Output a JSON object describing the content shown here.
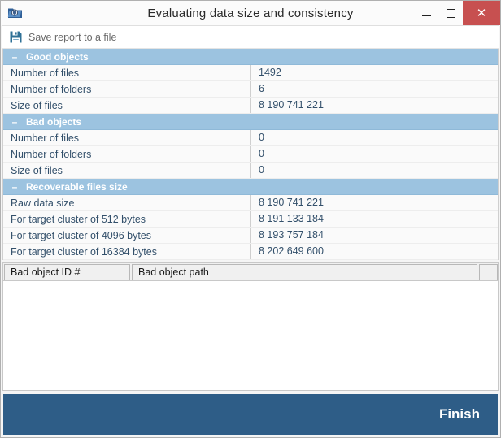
{
  "window": {
    "title": "Evaluating data size and consistency",
    "app_icon": "folder-shield-icon",
    "controls": {
      "minimize": "–",
      "maximize": "□",
      "close": "✕"
    },
    "close_color": "#c75050"
  },
  "toolbar": {
    "save_icon": "floppy-disk-icon",
    "save_label": "Save report to a file"
  },
  "sections": [
    {
      "title": "Good objects",
      "toggle": "–",
      "rows": [
        {
          "label": "Number of files",
          "value": "1492"
        },
        {
          "label": "Number of folders",
          "value": "6"
        },
        {
          "label": "Size of files",
          "value": "8 190 741 221"
        }
      ]
    },
    {
      "title": "Bad objects",
      "toggle": "–",
      "rows": [
        {
          "label": "Number of files",
          "value": "0"
        },
        {
          "label": "Number of folders",
          "value": "0"
        },
        {
          "label": "Size of files",
          "value": "0"
        }
      ]
    },
    {
      "title": "Recoverable files size",
      "toggle": "–",
      "rows": [
        {
          "label": "Raw data size",
          "value": "8 190 741 221"
        },
        {
          "label": "For target cluster of 512 bytes",
          "value": "8 191 133 184"
        },
        {
          "label": "For target cluster of 4096 bytes",
          "value": "8 193 757 184"
        },
        {
          "label": "For target cluster of 16384 bytes",
          "value": "8 202 649 600"
        }
      ]
    }
  ],
  "grid": {
    "columns": [
      "Bad object ID #",
      "Bad object path"
    ],
    "rows": []
  },
  "footer": {
    "finish_label": "Finish",
    "background": "#2e5d87"
  },
  "accent": {
    "section_header": "#9cc3e0",
    "text": "#33506b"
  }
}
